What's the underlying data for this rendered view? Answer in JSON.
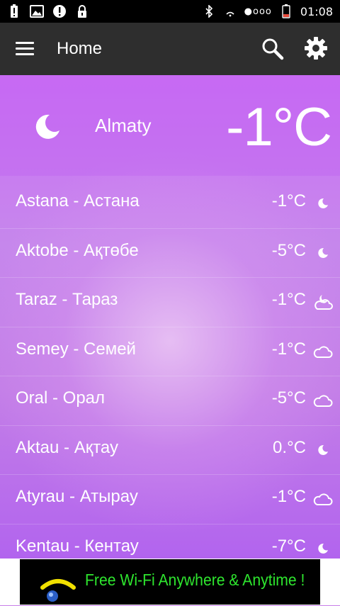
{
  "status_bar": {
    "time": "01:08",
    "signal": "●ooo"
  },
  "app_bar": {
    "title": "Home",
    "menu_icon": "hamburger-menu-icon",
    "search_icon": "search-icon",
    "settings_icon": "gear-icon"
  },
  "current": {
    "city": "Almaty",
    "temperature": "-1°C",
    "icon": "moon-icon"
  },
  "cities": [
    {
      "name": "Astana - Астана",
      "temp": "-1°C",
      "icon": "moon-icon"
    },
    {
      "name": "Aktobe - Ақтөбе",
      "temp": "-5°C",
      "icon": "moon-icon"
    },
    {
      "name": "Taraz - Тараз",
      "temp": "-1°C",
      "icon": "moon-cloud-icon"
    },
    {
      "name": "Semey - Семей",
      "temp": "-1°C",
      "icon": "cloud-icon"
    },
    {
      "name": "Oral - Орал",
      "temp": "-5°C",
      "icon": "cloud-icon"
    },
    {
      "name": "Aktau - Ақтау",
      "temp": "0.°C",
      "icon": "moon-icon"
    },
    {
      "name": "Atyrau - Атырау",
      "temp": "-1°C",
      "icon": "cloud-icon"
    },
    {
      "name": "Kentau - Кентау",
      "temp": "-7°C",
      "icon": "moon-icon"
    }
  ],
  "ad": {
    "text": "Free Wi-Fi Anywhere & Anytime !"
  },
  "colors": {
    "status_bar": "#000000",
    "app_bar": "#2e2e2e",
    "background": "#c77ee8",
    "ad_text": "#2ee52e"
  }
}
